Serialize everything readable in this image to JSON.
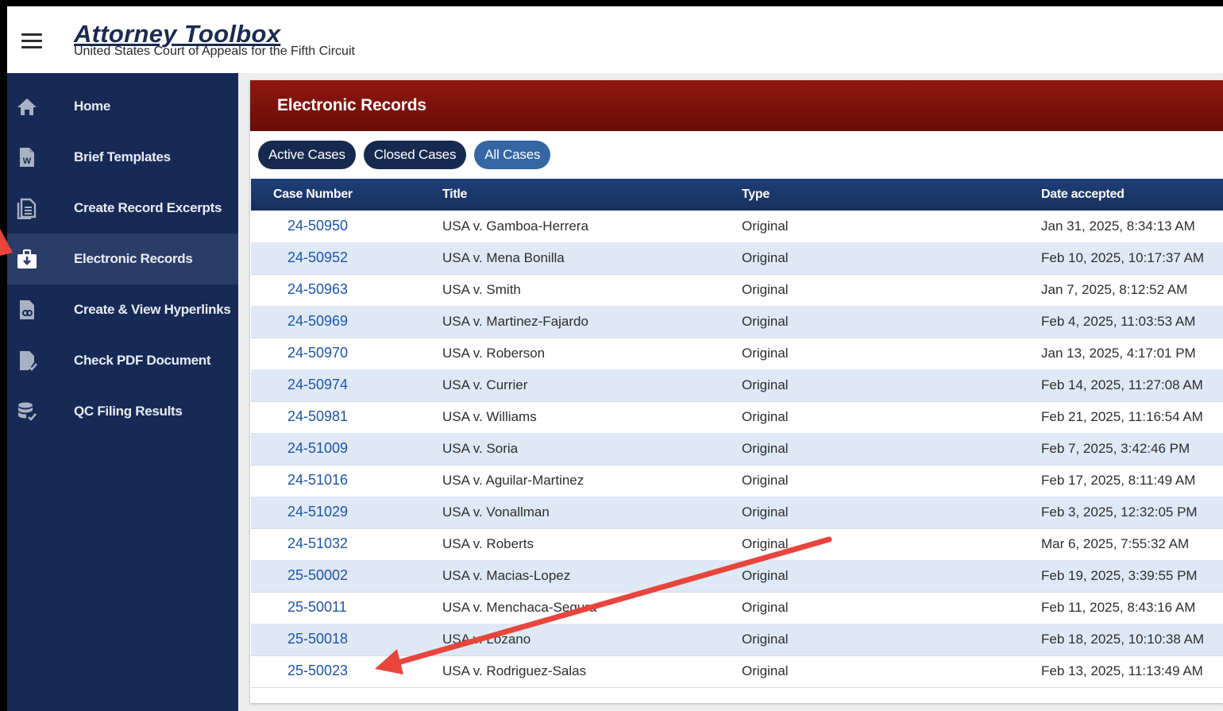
{
  "header": {
    "title": "Attorney Toolbox",
    "subtitle": "United States Court of Appeals for the Fifth Circuit",
    "menu_icon": "hamburger-menu-icon"
  },
  "sidebar": {
    "items": [
      {
        "label": "Home",
        "icon": "home-icon"
      },
      {
        "label": "Brief Templates",
        "icon": "word-document-icon"
      },
      {
        "label": "Create Record Excerpts",
        "icon": "document-icon"
      },
      {
        "label": "Electronic Records",
        "icon": "download-briefcase-icon",
        "active": true
      },
      {
        "label": "Create & View Hyperlinks",
        "icon": "link-document-icon"
      },
      {
        "label": "Check PDF Document",
        "icon": "document-check-icon"
      },
      {
        "label": "QC Filing Results",
        "icon": "database-check-icon"
      }
    ]
  },
  "main": {
    "title": "Electronic Records",
    "filters": [
      {
        "label": "Active Cases",
        "selected": false
      },
      {
        "label": "Closed Cases",
        "selected": false
      },
      {
        "label": "All Cases",
        "selected": true
      }
    ],
    "table": {
      "columns": [
        "Case Number",
        "Title",
        "Type",
        "Date accepted"
      ],
      "rows": [
        [
          "24-50950",
          "USA v. Gamboa-Herrera",
          "Original",
          "Jan 31, 2025, 8:34:13 AM"
        ],
        [
          "24-50952",
          "USA v. Mena Bonilla",
          "Original",
          "Feb 10, 2025, 10:17:37 AM"
        ],
        [
          "24-50963",
          "USA v. Smith",
          "Original",
          "Jan 7, 2025, 8:12:52 AM"
        ],
        [
          "24-50969",
          "USA v. Martinez-Fajardo",
          "Original",
          "Feb 4, 2025, 11:03:53 AM"
        ],
        [
          "24-50970",
          "USA v. Roberson",
          "Original",
          "Jan 13, 2025, 4:17:01 PM"
        ],
        [
          "24-50974",
          "USA v. Currier",
          "Original",
          "Feb 14, 2025, 11:27:08 AM"
        ],
        [
          "24-50981",
          "USA v. Williams",
          "Original",
          "Feb 21, 2025, 11:16:54 AM"
        ],
        [
          "24-51009",
          "USA v. Soria",
          "Original",
          "Feb 7, 2025, 3:42:46 PM"
        ],
        [
          "24-51016",
          "USA v. Aguilar-Martinez",
          "Original",
          "Feb 17, 2025, 8:11:49 AM"
        ],
        [
          "24-51029",
          "USA v. Vonallman",
          "Original",
          "Feb 3, 2025, 12:32:05 PM"
        ],
        [
          "24-51032",
          "USA v. Roberts",
          "Original",
          "Mar 6, 2025, 7:55:32 AM"
        ],
        [
          "25-50002",
          "USA v. Macias-Lopez",
          "Original",
          "Feb 19, 2025, 3:39:55 PM"
        ],
        [
          "25-50011",
          "USA v. Menchaca-Segura",
          "Original",
          "Feb 11, 2025, 8:43:16 AM"
        ],
        [
          "25-50018",
          "USA v. Lozano",
          "Original",
          "Feb 18, 2025, 10:10:38 AM"
        ],
        [
          "25-50023",
          "USA v. Rodriguez-Salas",
          "Original",
          "Feb 13, 2025, 11:13:49 AM"
        ]
      ]
    }
  },
  "annotations": {
    "color": "#e8453c"
  },
  "colors": {
    "sidebar_bg": "#172a55",
    "header_red": "#8f1810",
    "table_head": "#1f3f78",
    "row_alt": "#dfe9f6",
    "link": "#1e55a5",
    "pill_selected": "#3366a3",
    "pill": "#162a4f"
  }
}
